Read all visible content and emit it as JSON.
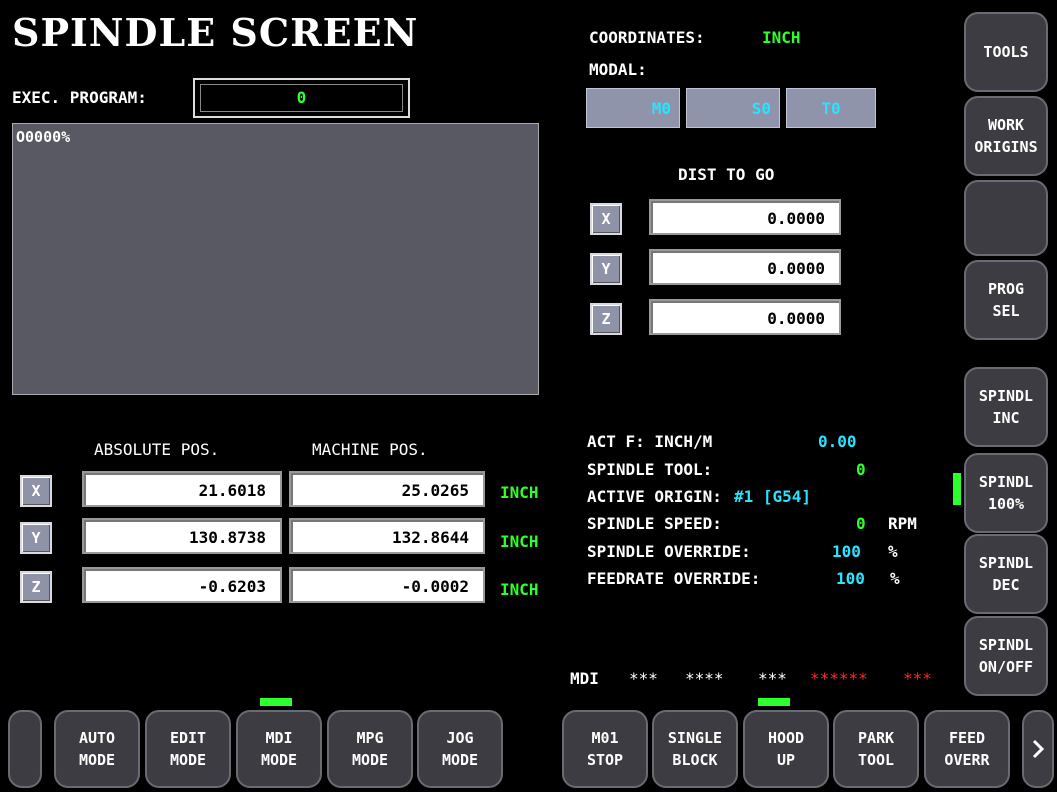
{
  "title": "SPINDLE SCREEN",
  "exec_program": {
    "label": "EXEC. PROGRAM:",
    "value": "0"
  },
  "program_text": "O0000%",
  "coordinates": {
    "label": "COORDINATES:",
    "value": "INCH"
  },
  "modal": {
    "label": "MODAL:",
    "m": "M0",
    "s": "S0",
    "t": "T0"
  },
  "dist_to_go": {
    "title": "DIST TO GO",
    "rows": [
      {
        "axis": "X",
        "value": "0.0000"
      },
      {
        "axis": "Y",
        "value": "0.0000"
      },
      {
        "axis": "Z",
        "value": "0.0000"
      }
    ]
  },
  "positions": {
    "abs_header": "ABSOLUTE POS.",
    "mach_header": "MACHINE POS.",
    "rows": [
      {
        "axis": "X",
        "abs": "21.6018",
        "mach": "25.0265",
        "unit": "INCH"
      },
      {
        "axis": "Y",
        "abs": "130.8738",
        "mach": "132.8644",
        "unit": "INCH"
      },
      {
        "axis": "Z",
        "abs": "-0.6203",
        "mach": "-0.0002",
        "unit": "INCH"
      }
    ]
  },
  "status": {
    "act_f_label": "ACT F: INCH/M",
    "act_f_value": "0.00",
    "spindle_tool_label": "SPINDLE TOOL:",
    "spindle_tool_value": "0",
    "active_origin_label": "ACTIVE ORIGIN:",
    "active_origin_value": "#1 [G54]",
    "spindle_speed_label": "SPINDLE SPEED:",
    "spindle_speed_value": "0",
    "spindle_speed_unit": "RPM",
    "spindle_override_label": "SPINDLE OVERRIDE:",
    "spindle_override_value": "100",
    "spindle_override_unit": "%",
    "feedrate_override_label": "FEEDRATE OVERRIDE:",
    "feedrate_override_value": "100",
    "feedrate_override_unit": "%"
  },
  "mdi_line": {
    "mode": "MDI",
    "w1": "***",
    "w2": "****",
    "w3": "***",
    "r1": "******",
    "r2": "***"
  },
  "right_buttons": {
    "tools": "TOOLS",
    "work_origins_1": "WORK",
    "work_origins_2": "ORIGINS",
    "blank": "",
    "prog_sel_1": "PROG",
    "prog_sel_2": "SEL",
    "spindl_inc_1": "SPINDL",
    "spindl_inc_2": "INC",
    "spindl_100_1": "SPINDL",
    "spindl_100_2": "100%",
    "spindl_dec_1": "SPINDL",
    "spindl_dec_2": "DEC",
    "spindl_onoff_1": "SPINDL",
    "spindl_onoff_2": "ON/OFF"
  },
  "bottom_buttons": [
    {
      "l1": "AUTO",
      "l2": "MODE"
    },
    {
      "l1": "EDIT",
      "l2": "MODE"
    },
    {
      "l1": "MDI",
      "l2": "MODE"
    },
    {
      "l1": "MPG",
      "l2": "MODE"
    },
    {
      "l1": "JOG",
      "l2": "MODE"
    },
    {
      "l1": "M01",
      "l2": "STOP"
    },
    {
      "l1": "SINGLE",
      "l2": "BLOCK"
    },
    {
      "l1": "HOOD",
      "l2": "UP"
    },
    {
      "l1": "PARK",
      "l2": "TOOL"
    },
    {
      "l1": "FEED",
      "l2": "OVERR"
    }
  ],
  "icons": {
    "next": "chevron-right-icon"
  },
  "colors": {
    "value_green": "#2dff2d",
    "value_cyan": "#29e3ff",
    "alarm_red": "#ff2a2a",
    "button_bg": "#3c3c42",
    "chip_bg": "#8f94ab"
  }
}
